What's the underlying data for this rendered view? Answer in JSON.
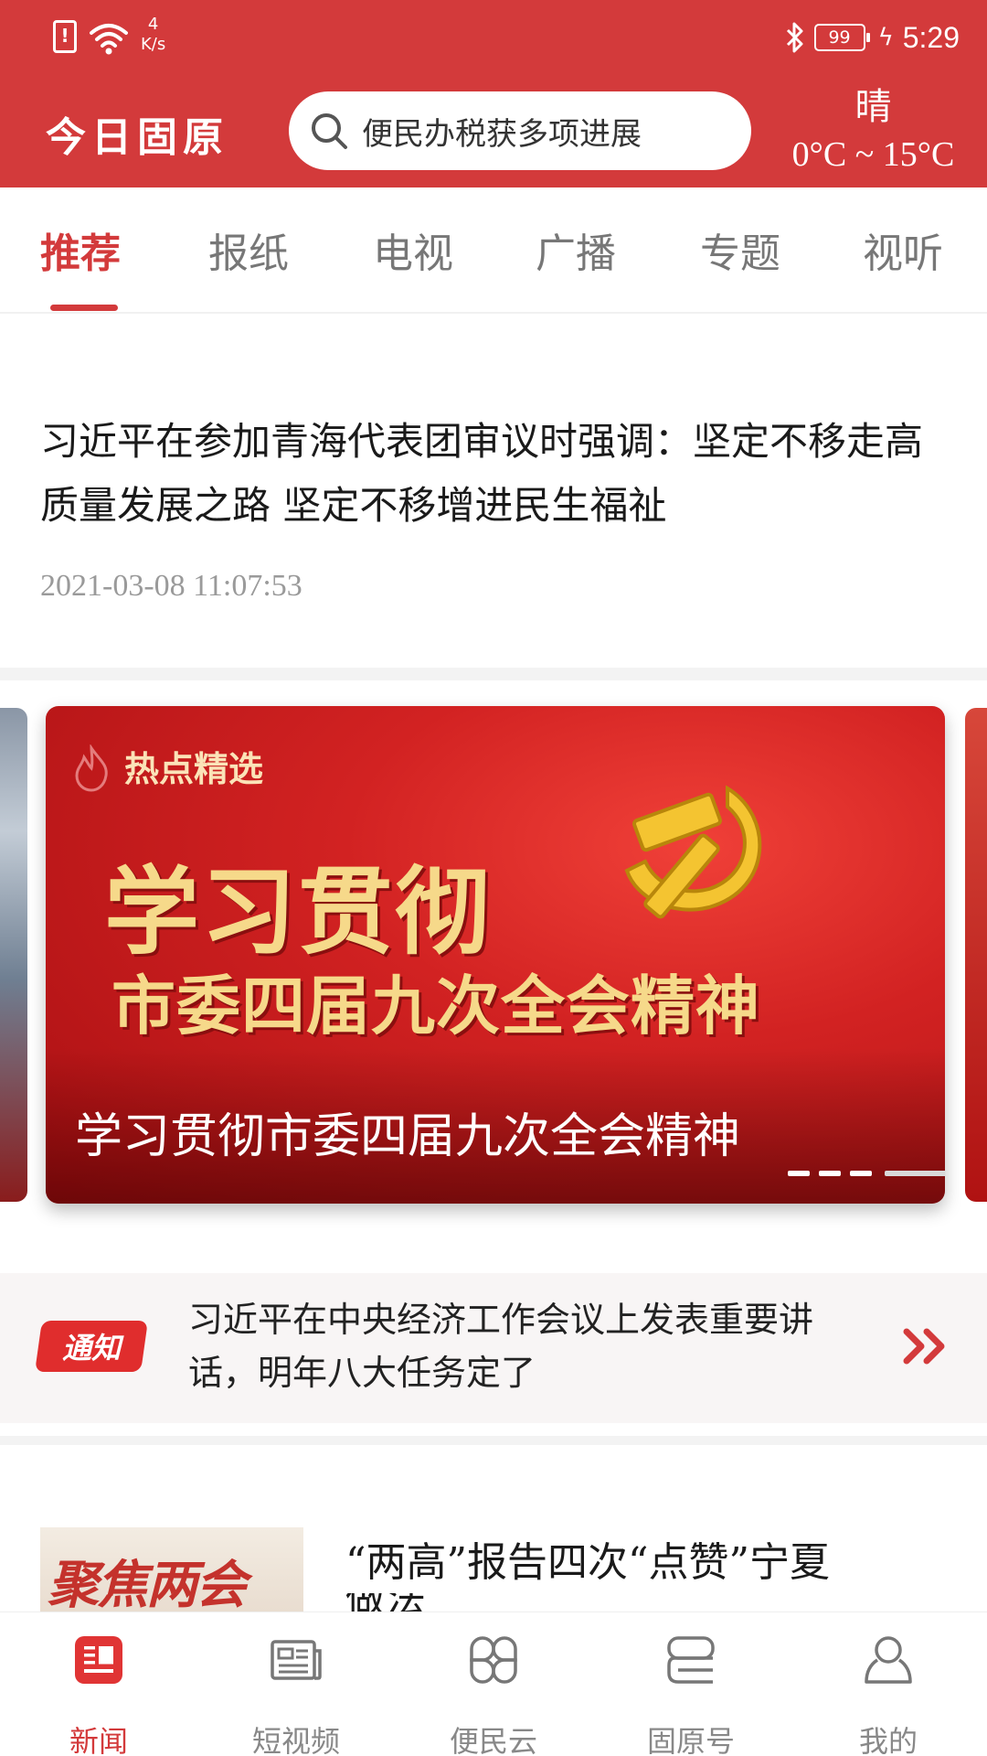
{
  "status_bar": {
    "net_speed_value": "4",
    "net_speed_unit": "K/s",
    "battery": "99",
    "time": "5:29"
  },
  "app_bar": {
    "logo": "今日固原",
    "search_placeholder": "便民办税获多项进展",
    "weather_condition": "晴",
    "weather_temp": "0°C ~ 15°C"
  },
  "tabs": [
    {
      "label": "推荐",
      "active": true
    },
    {
      "label": "报纸",
      "active": false
    },
    {
      "label": "电视",
      "active": false
    },
    {
      "label": "广播",
      "active": false
    },
    {
      "label": "专题",
      "active": false
    },
    {
      "label": "视听",
      "active": false
    }
  ],
  "headline": {
    "title": "习近平在参加青海代表团审议时强调：坚定不移走高质量发展之路 坚定不移增进民生福祉",
    "time": "2021-03-08 11:07:53"
  },
  "banner": {
    "tag": "热点精选",
    "big_line": "学习贯彻",
    "sub_line": "市委四届九次全会精神",
    "caption": "学习贯彻市委四届九次全会精神",
    "slide_count": 4,
    "active_slide": 4
  },
  "notice": {
    "badge": "通知",
    "text": "习近平在中央经济工作会议上发表重要讲话，明年八大任务定了"
  },
  "article": {
    "thumb_text": "聚焦两会",
    "title": "“两高”报告四次“点赞”宁夏",
    "title_cont": "做法"
  },
  "bottom_nav": [
    {
      "label": "新闻",
      "icon": "news-icon",
      "active": true
    },
    {
      "label": "短视频",
      "icon": "short-video-icon",
      "active": false
    },
    {
      "label": "便民云",
      "icon": "services-grid-icon",
      "active": false
    },
    {
      "label": "固原号",
      "icon": "account-icon",
      "active": false
    },
    {
      "label": "我的",
      "icon": "profile-icon",
      "active": false
    }
  ],
  "colors": {
    "brand_red": "#d33a3b",
    "banner_gold": "#f6d98a"
  }
}
